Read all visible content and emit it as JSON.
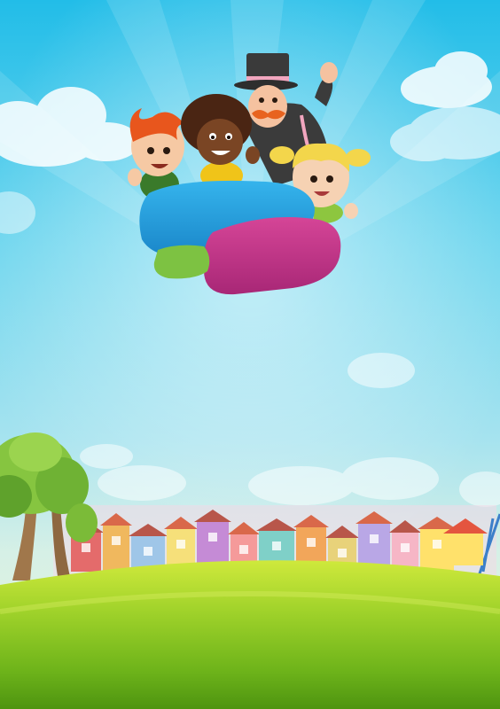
{
  "scene": {
    "description_kind": "cartoon-illustration",
    "sky_colors": [
      "#29c4ec",
      "#5fd4ef",
      "#a9e4f0",
      "#d8f0d8"
    ],
    "grass_colors": [
      "#c7e83a",
      "#7fc31c",
      "#4f9a10"
    ],
    "logo": {
      "blob_colors": {
        "blue": "#2aa3e0",
        "magenta": "#c8368f",
        "green": "#7dc242"
      },
      "text": ""
    },
    "characters": [
      {
        "name": "red-haired-boy",
        "hair": "#e8561d",
        "shirt": "#3a7a2a"
      },
      {
        "name": "curly-haired-boy",
        "hair": "#4a2513",
        "shirt": "#f0c419"
      },
      {
        "name": "top-hat-man",
        "hat": "#3a3a3a",
        "mustache": "#e8631f",
        "suit": "#3b3b3b"
      },
      {
        "name": "blonde-girl",
        "hair": "#f3d64b",
        "shirt": "#8dc63f"
      }
    ],
    "houses": [
      {
        "color": "#e46b6b"
      },
      {
        "color": "#f0b85e"
      },
      {
        "color": "#9fc6e8"
      },
      {
        "color": "#f6e07a"
      },
      {
        "color": "#c58bd6"
      },
      {
        "color": "#f59a9a"
      },
      {
        "color": "#7fd0c8"
      },
      {
        "color": "#f2a65a"
      },
      {
        "color": "#e8d27a"
      },
      {
        "color": "#b9a7e6"
      },
      {
        "color": "#f6b6c6"
      },
      {
        "color": "#ffe16b"
      }
    ]
  }
}
